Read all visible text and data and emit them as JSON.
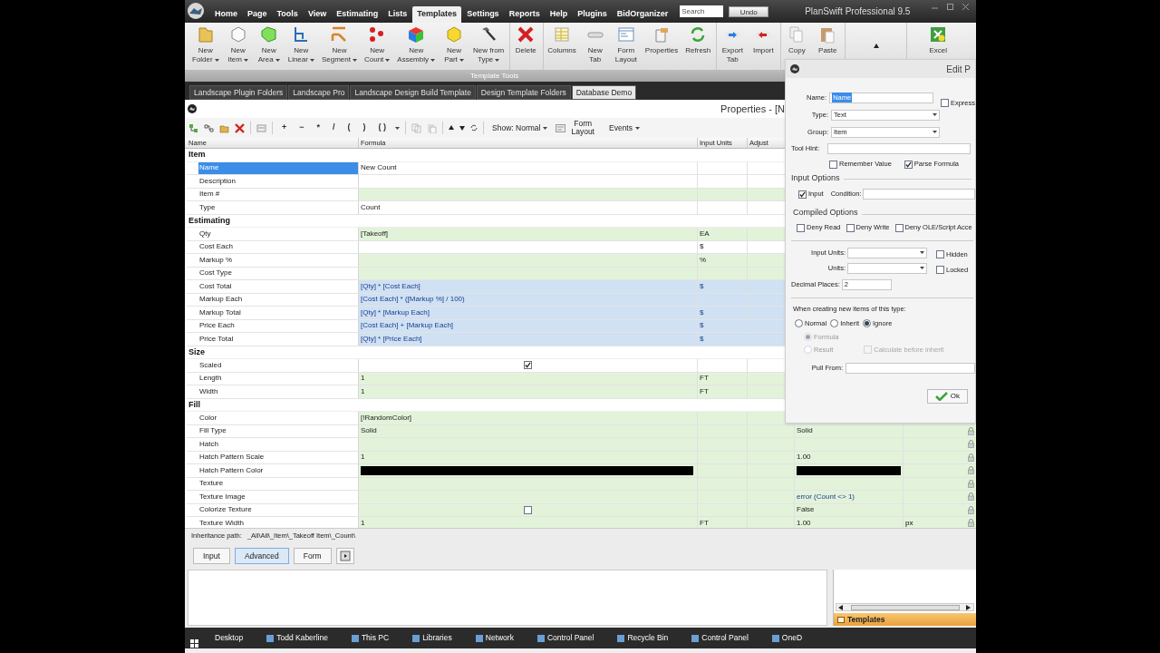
{
  "title_bar": {
    "menu": [
      {
        "label": "Home",
        "selected": false
      },
      {
        "label": "Page",
        "selected": false
      },
      {
        "label": "Tools",
        "selected": false
      },
      {
        "label": "View",
        "selected": false
      },
      {
        "label": "Estimating",
        "selected": false
      },
      {
        "label": "Lists",
        "selected": false
      },
      {
        "label": "Templates",
        "selected": true
      },
      {
        "label": "Settings",
        "selected": false
      },
      {
        "label": "Reports",
        "selected": false
      },
      {
        "label": "Help",
        "selected": false
      },
      {
        "label": "Plugins",
        "selected": false
      },
      {
        "label": "BidOrganizer",
        "selected": false
      }
    ],
    "search": {
      "placeholder": "Search"
    },
    "undo": "Undo",
    "title": "PlanSwift Professional 9.5"
  },
  "ribbon": {
    "groups": [
      [
        {
          "lines": [
            "New",
            "Folder"
          ],
          "dropdown": true
        },
        {
          "lines": [
            "New",
            "Item"
          ],
          "dropdown": true
        },
        {
          "lines": [
            "New",
            "Area"
          ],
          "dropdown": true
        },
        {
          "lines": [
            "New",
            "Linear"
          ],
          "dropdown": true
        },
        {
          "lines": [
            "New",
            "Segment"
          ],
          "dropdown": true
        },
        {
          "lines": [
            "New",
            "Count"
          ],
          "dropdown": true
        },
        {
          "lines": [
            "New",
            "Assembly"
          ],
          "dropdown": true
        },
        {
          "lines": [
            "New",
            "Part"
          ],
          "dropdown": true
        },
        {
          "lines": [
            "New from",
            "Type"
          ],
          "dropdown": true
        }
      ],
      [
        {
          "lines": [
            "Delete"
          ],
          "dropdown": false
        }
      ],
      [
        {
          "lines": [
            "Columns"
          ],
          "dropdown": false
        },
        {
          "lines": [
            "New",
            "Tab"
          ],
          "dropdown": false
        },
        {
          "lines": [
            "Form",
            "Layout"
          ],
          "dropdown": false
        },
        {
          "lines": [
            "Properties"
          ],
          "dropdown": false
        },
        {
          "lines": [
            "Refresh"
          ],
          "dropdown": false
        }
      ],
      [
        {
          "lines": [
            "Export",
            "Tab"
          ],
          "dropdown": false
        },
        {
          "lines": [
            "Import"
          ],
          "dropdown": false
        }
      ],
      [
        {
          "lines": [
            "Copy"
          ],
          "dropdown": false
        },
        {
          "lines": [
            "Paste"
          ],
          "dropdown": false
        }
      ],
      [
        {
          "lines": [
            "Excel"
          ],
          "dropdown": false
        }
      ]
    ],
    "group_label": "Template Tools"
  },
  "tabs": [
    {
      "label": "Landscape Plugin Folders",
      "selected": false
    },
    {
      "label": "Landscape Pro",
      "selected": false
    },
    {
      "label": "Landscape Design Build Template",
      "selected": false
    },
    {
      "label": "Design Template Folders",
      "selected": false
    },
    {
      "label": "Database Demo",
      "selected": true
    }
  ],
  "properties": {
    "title": "Properties - [N",
    "operators": [
      "+",
      "−",
      "*",
      "/",
      "(",
      ")",
      "( )"
    ],
    "show": "Show: Normal",
    "form_layout": [
      "Form",
      "Layout"
    ],
    "events": "Events"
  },
  "grid": {
    "columns": [
      "Name",
      "Formula",
      "Input Units",
      "Adjust"
    ],
    "groups": [
      {
        "title": "Item",
        "rows": [
          {
            "name": "Name",
            "formula": "New Count",
            "kind": "text",
            "shaded": false,
            "calculated": false,
            "selected": true
          },
          {
            "name": "Description",
            "kind": "text",
            "shaded": false,
            "calculated": false,
            "selected": false
          },
          {
            "name": "Item #",
            "kind": "text",
            "shaded": true,
            "calculated": false,
            "selected": false
          },
          {
            "name": "Type",
            "formula": "Count",
            "kind": "text",
            "shaded": false,
            "calculated": false,
            "selected": false
          }
        ]
      },
      {
        "title": "Estimating",
        "rows": [
          {
            "name": "Qty",
            "formula": "[Takeoff]",
            "units": "EA",
            "kind": "text",
            "shaded": true,
            "calculated": false,
            "selected": false
          },
          {
            "name": "Cost Each",
            "units": "$",
            "kind": "text",
            "shaded": false,
            "calculated": false,
            "selected": false
          },
          {
            "name": "Markup %",
            "units": "%",
            "kind": "text",
            "shaded": true,
            "calculated": false,
            "selected": false
          },
          {
            "name": "Cost Type",
            "kind": "text",
            "shaded": true,
            "calculated": false,
            "selected": false
          },
          {
            "name": "Cost Total",
            "formula": "[Qty] * [Cost Each]",
            "units": "$",
            "kind": "text",
            "calculated": true,
            "selected": false
          },
          {
            "name": "Markup Each",
            "formula": "[Cost Each] * ([Markup %] / 100)",
            "kind": "text",
            "calculated": true,
            "selected": false
          },
          {
            "name": "Markup Total",
            "formula": "[Qty] * [Markup Each]",
            "units": "$",
            "kind": "text",
            "calculated": true,
            "selected": false
          },
          {
            "name": "Price Each",
            "formula": "[Cost Each] + [Markup Each]",
            "units": "$",
            "kind": "text",
            "calculated": true,
            "selected": false
          },
          {
            "name": "Price Total",
            "formula": "[Qty] * [Price Each]",
            "units": "$",
            "kind": "text",
            "calculated": true,
            "selected": false
          }
        ]
      },
      {
        "title": "Size",
        "rows": [
          {
            "name": "Scaled",
            "kind": "check",
            "checked": true,
            "shaded": false,
            "calculated": false,
            "selected": false
          },
          {
            "name": "Length",
            "formula": "1",
            "units": "FT",
            "kind": "text",
            "shaded": true,
            "calculated": false,
            "selected": false
          },
          {
            "name": "Width",
            "formula": "1",
            "units": "FT",
            "kind": "text",
            "shaded": true,
            "calculated": false,
            "selected": false
          }
        ]
      },
      {
        "title": "Fill",
        "rows": [
          {
            "name": "Color",
            "formula": "[!RandomColor]",
            "kind": "text",
            "shaded": true,
            "calculated": false,
            "selected": false
          },
          {
            "name": "Fill Type",
            "formula": "Solid",
            "value": "Solid",
            "kind": "text",
            "shaded": true,
            "calculated": false,
            "selected": false,
            "locked": true
          },
          {
            "name": "Hatch",
            "kind": "text",
            "shaded": true,
            "calculated": false,
            "selected": false,
            "locked": true
          },
          {
            "name": "Hatch Pattern Scale",
            "formula": "1",
            "value": "1.00",
            "kind": "text",
            "shaded": true,
            "calculated": false,
            "selected": false,
            "locked": true
          },
          {
            "name": "Hatch Pattern Color",
            "color": "#000000",
            "kind": "swatch",
            "shaded": true,
            "calculated": false,
            "selected": false,
            "locked": true
          },
          {
            "name": "Texture",
            "kind": "text",
            "shaded": true,
            "calculated": false,
            "selected": false,
            "locked": true
          },
          {
            "name": "Texture Image",
            "value": "error (Count <> 1)",
            "kind": "text",
            "shaded": true,
            "calculated": false,
            "selected": false,
            "locked": true
          },
          {
            "name": "Colorize Texture",
            "value": "False",
            "kind": "check",
            "checked": false,
            "shaded": true,
            "calculated": false,
            "selected": false,
            "locked": true
          },
          {
            "name": "Texture Width",
            "formula": "1",
            "units": "FT",
            "value": "1.00",
            "unit2": "px",
            "kind": "text",
            "shaded": true,
            "calculated": false,
            "selected": false,
            "locked": true
          }
        ]
      }
    ]
  },
  "inheritance": {
    "label": "Inheritance path:",
    "path": "_All\\All\\_Item\\_Takeoff Item\\_Count\\"
  },
  "view_buttons": [
    {
      "label": "Input",
      "selected": false
    },
    {
      "label": "Advanced",
      "selected": true
    },
    {
      "label": "Form",
      "selected": false
    }
  ],
  "templates_panel": {
    "title": "Templates"
  },
  "dialog": {
    "title": "Edit P",
    "name": {
      "label": "Name:",
      "value": "Name",
      "value_selected": true
    },
    "type": {
      "label": "Type:",
      "value": "Text"
    },
    "group": {
      "label": "Group:",
      "value": "Item"
    },
    "express": {
      "label": "Express",
      "checked": false
    },
    "tool_hint": {
      "label": "Tool Hint:"
    },
    "remember_value": {
      "label": "Remember Value",
      "checked": false
    },
    "parse_formula": {
      "label": "Parse Formula",
      "checked": true
    },
    "input_options": {
      "title": "Input Options",
      "input": {
        "label": "Input",
        "checked": true
      },
      "condition": {
        "label": "Condition:"
      }
    },
    "compiled_options": {
      "title": "Compiled Options",
      "checks": [
        {
          "label": "Deny Read",
          "checked": false
        },
        {
          "label": "Deny Write",
          "checked": false
        },
        {
          "label": "Deny OLE/Script Acce",
          "checked": false
        }
      ]
    },
    "input_units": {
      "label": "Input Units:"
    },
    "units": {
      "label": "Units:"
    },
    "hidden": {
      "label": "Hidden",
      "checked": false
    },
    "locked": {
      "label": "Locked",
      "checked": false
    },
    "decimal_places": {
      "label": "Decimal Places:",
      "value": "2"
    },
    "new_items": {
      "prompt": "When creating new items of this type:",
      "options": [
        {
          "label": "Normal",
          "selected": false
        },
        {
          "label": "Inherit",
          "selected": false
        },
        {
          "label": "Ignore",
          "selected": true
        }
      ]
    },
    "source": {
      "disabled": true,
      "options": [
        {
          "label": "Formula",
          "selected": true
        },
        {
          "label": "Result",
          "selected": false
        }
      ]
    },
    "calculate_before_inherit": {
      "label": "Calculate before inherit",
      "checked": false,
      "disabled": true
    },
    "pull_from": {
      "label": "Pull From:"
    },
    "ok": "Ok"
  },
  "taskbar": [
    "Desktop",
    "Todd Kaberline",
    "This PC",
    "Libraries",
    "Network",
    "Control Panel",
    "Recycle Bin",
    "Control Panel",
    "OneD"
  ]
}
